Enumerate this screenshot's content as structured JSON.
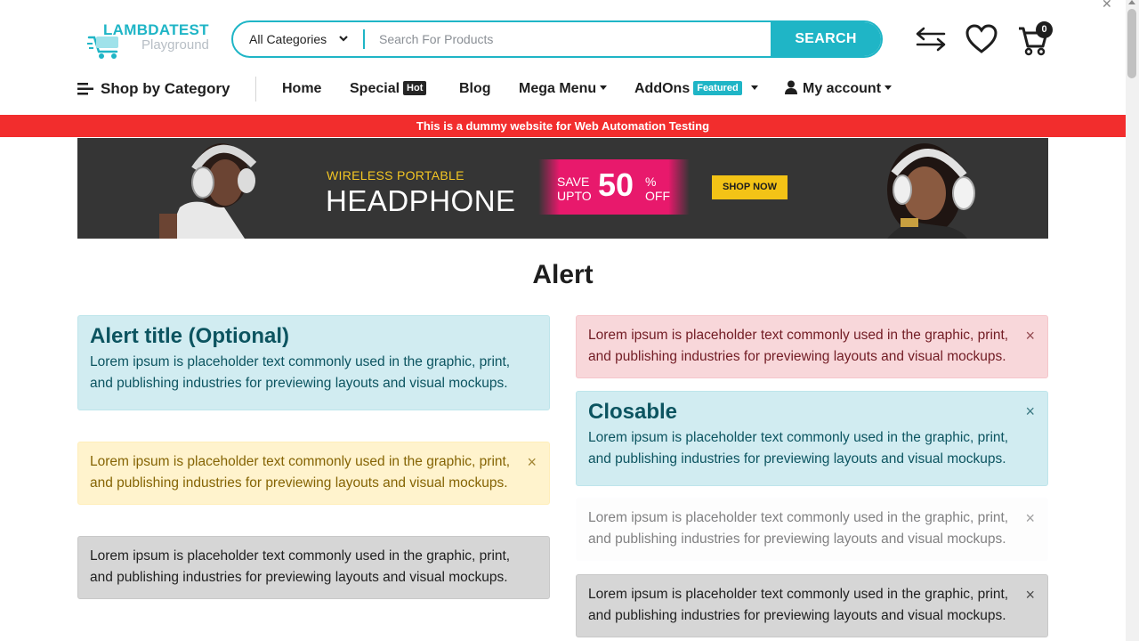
{
  "header": {
    "logo_text": "LAMBDATEST",
    "logo_sub": "Playground",
    "search": {
      "category": "All Categories",
      "placeholder": "Search For Products",
      "button": "SEARCH"
    },
    "cart_count": "0"
  },
  "nav": {
    "shop_by_category": "Shop by Category",
    "items": {
      "home": "Home",
      "special": "Special",
      "special_badge": "Hot",
      "blog": "Blog",
      "mega_menu": "Mega Menu",
      "addons": "AddOns",
      "addons_badge": "Featured",
      "my_account": "My account"
    }
  },
  "notice": "This is a dummy website for Web Automation Testing",
  "banner": {
    "subtitle": "WIRELESS PORTABLE",
    "title": "HEADPHONE",
    "save_left_1": "SAVE",
    "save_left_2": "UPTO",
    "save_percent": "50",
    "save_right_1": "%",
    "save_right_2": "OFF",
    "cta": "SHOP NOW"
  },
  "page_title": "Alert",
  "alerts": {
    "left": [
      {
        "title": "Alert title (Optional)",
        "text": "Lorem ipsum is placeholder text commonly used in the graphic, print, and publishing industries for previewing layouts and visual mockups."
      },
      {
        "text": "Lorem ipsum is placeholder text commonly used in the graphic, print, and publishing industries for previewing layouts and visual mockups."
      },
      {
        "text": "Lorem ipsum is placeholder text commonly used in the graphic, print, and publishing industries for previewing layouts and visual mockups."
      }
    ],
    "right": [
      {
        "text": "Lorem ipsum is placeholder text commonly used in the graphic, print, and publishing industries for previewing layouts and visual mockups."
      },
      {
        "title": "Closable",
        "text": "Lorem ipsum is placeholder text commonly used in the graphic, print, and publishing industries for previewing layouts and visual mockups."
      },
      {
        "text": "Lorem ipsum is placeholder text commonly used in the graphic, print, and publishing industries for previewing layouts and visual mockups."
      },
      {
        "text": "Lorem ipsum is placeholder text commonly used in the graphic, print, and publishing industries for previewing layouts and visual mockups."
      }
    ],
    "close_glyph": "×"
  },
  "colors": {
    "accent": "#1fb5c6",
    "notice_red": "#f22d2d",
    "banner_bg": "#353535",
    "save_pink": "#e8196c",
    "shop_yellow": "#f3c316"
  },
  "icons": [
    "cart-logo-icon",
    "chevron-down-icon",
    "compare-icon",
    "heart-icon",
    "cart-icon",
    "hamburger-icon",
    "user-icon",
    "close-icon"
  ]
}
